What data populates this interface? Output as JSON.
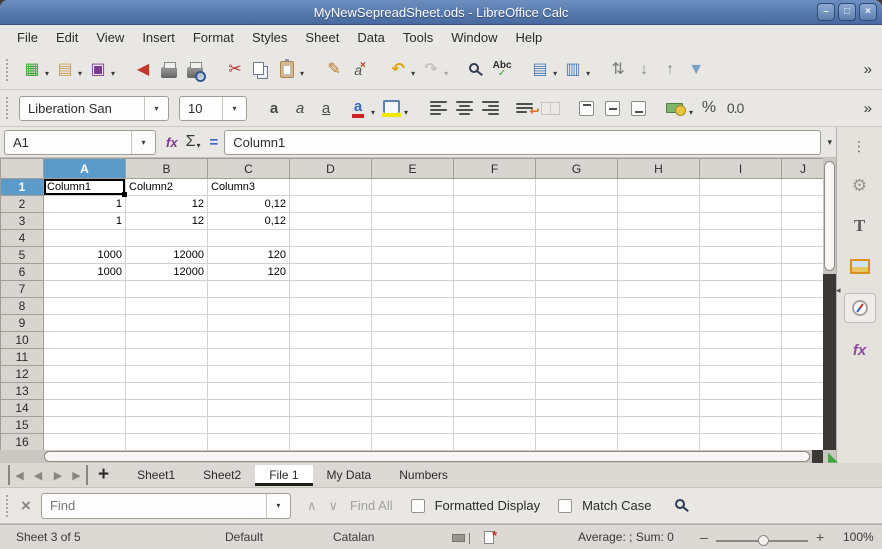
{
  "window": {
    "title": "MyNewSepreadSheet.ods - LibreOffice Calc",
    "minimize": "–",
    "maximize": "□",
    "close": "×"
  },
  "menu": {
    "items": [
      "File",
      "Edit",
      "View",
      "Insert",
      "Format",
      "Styles",
      "Sheet",
      "Data",
      "Tools",
      "Window",
      "Help"
    ]
  },
  "toolbar": {
    "new": "▦",
    "open": "▤",
    "save": "▣",
    "pdf": "◀",
    "cut": "✂",
    "clone": "✎",
    "clear_a": "a",
    "clear_x": "×",
    "undo": "↶",
    "redo": "↷",
    "abc": "Abc",
    "check": "✓",
    "rows": "▤",
    "cols": "▥",
    "sort": "⇅",
    "sort_desc": "↓",
    "sort_asc": "↑",
    "filter": "▼",
    "dropdown": "▾",
    "overflow": "»"
  },
  "formatting": {
    "font_name": "Liberation San",
    "font_size": "10",
    "bold": "a",
    "italic": "a",
    "underline": "a",
    "font_color": "a",
    "wrap_arrow": "↩",
    "percent": "%",
    "number": "0.0",
    "overflow": "»"
  },
  "formula_bar": {
    "name_box": "A1",
    "fx": "fx",
    "sigma": "Σ",
    "equals": "=",
    "content": "Column1",
    "expand": "▾",
    "dropdown": "▾"
  },
  "grid": {
    "columns": [
      "A",
      "B",
      "C",
      "D",
      "E",
      "F",
      "G",
      "H",
      "I",
      "J"
    ],
    "rows": [
      "1",
      "2",
      "3",
      "4",
      "5",
      "6",
      "7",
      "8",
      "9",
      "10",
      "11",
      "12",
      "13",
      "14",
      "15",
      "16"
    ],
    "cells": {
      "r1": [
        "Column1",
        "Column2",
        "Column3"
      ],
      "r2": [
        "1",
        "12",
        "0,12"
      ],
      "r3": [
        "1",
        "12",
        "0,12"
      ],
      "r5": [
        "1000",
        "12000",
        "120"
      ],
      "r6": [
        "1000",
        "12000",
        "120"
      ]
    },
    "selection": "A1"
  },
  "sheet_bar": {
    "nav_first": "◀",
    "nav_prev": "◀",
    "nav_next": "▶",
    "nav_last": "▶",
    "add": "+",
    "tabs": [
      "Sheet1",
      "Sheet2",
      "File 1",
      "My Data",
      "Numbers"
    ],
    "active_tab": "File 1"
  },
  "find_bar": {
    "close": "×",
    "placeholder": "Find",
    "dropdown": "▾",
    "prev": "∧",
    "next": "∨",
    "find_all": "Find All",
    "formatted_display": "Formatted Display",
    "match_case": "Match Case"
  },
  "sidebar": {
    "menu_dots": "⋮",
    "styles_t": "T",
    "styles_tri": "◣",
    "fx": "fx",
    "collapse": "◂"
  },
  "status_bar": {
    "sheet_position": "Sheet 3 of 5",
    "page_style": "Default",
    "language": "Catalan",
    "modified_mark": "*",
    "summary": "Average: ; Sum: 0",
    "zoom_out": "–",
    "zoom_in": "+",
    "zoom_level": "100%"
  },
  "colors": {
    "titlebar": "#5a7fb4",
    "header_selected": "#5b9bc9",
    "accent_red": "#cc2222",
    "highlight_yellow": "#f3e600"
  }
}
